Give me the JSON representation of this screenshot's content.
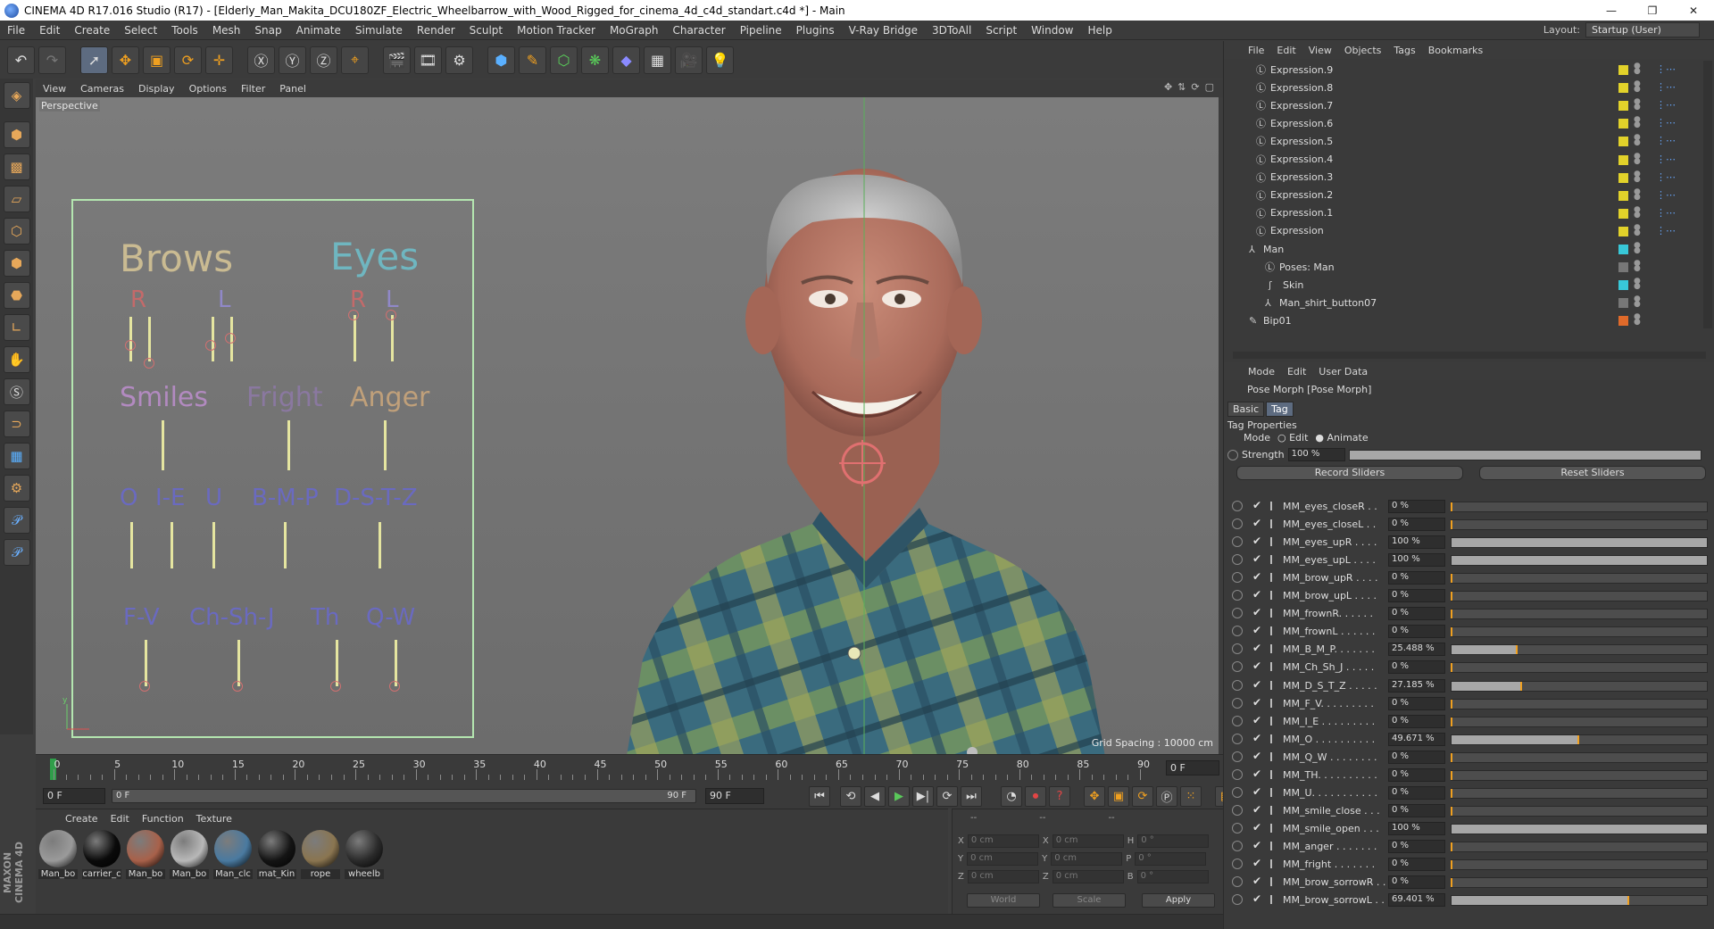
{
  "window": {
    "title": "CINEMA 4D R17.016 Studio (R17) - [Elderly_Man_Makita_DCU180ZF_Electric_Wheelbarrow_with_Wood_Rigged_for_cinema_4d_c4d_standart.c4d *] - Main",
    "controls": [
      "—",
      "❐",
      "✕"
    ]
  },
  "menubar": {
    "items": [
      "File",
      "Edit",
      "Create",
      "Select",
      "Tools",
      "Mesh",
      "Snap",
      "Animate",
      "Simulate",
      "Render",
      "Sculpt",
      "Motion Tracker",
      "MoGraph",
      "Character",
      "Pipeline",
      "Plugins",
      "V-Ray Bridge",
      "3DToAll",
      "Script",
      "Window",
      "Help"
    ],
    "layout_label": "Layout:",
    "layout_value": "Startup (User)"
  },
  "viewport": {
    "menu": [
      "View",
      "Cameras",
      "Display",
      "Options",
      "Filter",
      "Panel"
    ],
    "label": "Perspective",
    "grid_spacing": "Grid Spacing : 10000 cm",
    "face_panel": {
      "brows": "Brows",
      "eyes": "Eyes",
      "r1": "R",
      "l1": "L",
      "r2": "R",
      "l2": "L",
      "smiles": "Smiles",
      "fright": "Fright",
      "anger": "Anger",
      "o": "O",
      "ie": "I-E",
      "u": "U",
      "bmp": "B-M-P",
      "dstz": "D-S-T-Z",
      "fv": "F-V",
      "chshj": "Ch-Sh-J",
      "th": "Th",
      "qw": "Q-W"
    }
  },
  "timeline": {
    "ticks": [
      "0",
      "5",
      "10",
      "15",
      "20",
      "25",
      "30",
      "35",
      "40",
      "45",
      "50",
      "55",
      "60",
      "65",
      "70",
      "75",
      "80",
      "85",
      "90"
    ],
    "current_frame": "0 F",
    "start": "0 F",
    "range_left": "0 F",
    "range_right": "90 F",
    "end": "90 F"
  },
  "materials": {
    "menu": [
      "Create",
      "Edit",
      "Function",
      "Texture"
    ],
    "items": [
      {
        "name": "Man_bo",
        "color": "#9a9a9a"
      },
      {
        "name": "carrier_c",
        "color": "#0a0a0a"
      },
      {
        "name": "Man_bo",
        "color": "#a8614a"
      },
      {
        "name": "Man_bo",
        "color": "#b8b8b8"
      },
      {
        "name": "Man_clc",
        "color": "#4a7aa0"
      },
      {
        "name": "mat_Kin",
        "color": "#141414"
      },
      {
        "name": "rope",
        "color": "#8a7550"
      },
      {
        "name": "wheelb",
        "color": "#2a2a2a"
      }
    ]
  },
  "coords": {
    "col_headers": [
      "--",
      "--",
      "--"
    ],
    "x_label": "X",
    "y_label": "Y",
    "z_label": "Z",
    "h_label": "H",
    "p_label": "P",
    "b_label": "B",
    "pos": [
      "0 cm",
      "0 cm",
      "0 cm"
    ],
    "size": [
      "0 cm",
      "0 cm",
      "0 cm"
    ],
    "rot": [
      "0 °",
      "0 °",
      "0 °"
    ],
    "world": "World",
    "scale": "Scale",
    "apply": "Apply"
  },
  "objects": {
    "menu": [
      "File",
      "Edit",
      "View",
      "Objects",
      "Tags",
      "Bookmarks"
    ],
    "rows": [
      {
        "name": "Expression.9",
        "color": "#e2d22a"
      },
      {
        "name": "Expression.8",
        "color": "#e2d22a"
      },
      {
        "name": "Expression.7",
        "color": "#e2d22a"
      },
      {
        "name": "Expression.6",
        "color": "#e2d22a"
      },
      {
        "name": "Expression.5",
        "color": "#e2d22a"
      },
      {
        "name": "Expression.4",
        "color": "#e2d22a"
      },
      {
        "name": "Expression.3",
        "color": "#e2d22a"
      },
      {
        "name": "Expression.2",
        "color": "#e2d22a"
      },
      {
        "name": "Expression.1",
        "color": "#e2d22a"
      },
      {
        "name": "Expression",
        "color": "#e2d22a"
      },
      {
        "name": "Man",
        "color": "#38c8d8"
      },
      {
        "name": "Poses: Man",
        "color": "#777777"
      },
      {
        "name": "Skin",
        "color": "#38c8d8"
      },
      {
        "name": "Man_shirt_button07",
        "color": "#777777"
      },
      {
        "name": "Bip01",
        "color": "#e06a2a"
      }
    ]
  },
  "attributes": {
    "menu": [
      "Mode",
      "Edit",
      "User Data"
    ],
    "title": "Pose Morph [Pose Morph]",
    "tabs": [
      "Basic",
      "Tag"
    ],
    "section": "Tag Properties",
    "mode_label": "Mode",
    "mode_edit": "Edit",
    "mode_animate": "Animate",
    "strength_label": "Strength",
    "strength_value": "100 %",
    "record": "Record Sliders",
    "reset": "Reset Sliders",
    "sliders": [
      {
        "name": "MM_eyes_closeR . .",
        "value": "0 %",
        "fraction": 0
      },
      {
        "name": "MM_eyes_closeL . .",
        "value": "0 %",
        "fraction": 0
      },
      {
        "name": "MM_eyes_upR . . . .",
        "value": "100 %",
        "fraction": 1
      },
      {
        "name": "MM_eyes_upL . . . .",
        "value": "100 %",
        "fraction": 1
      },
      {
        "name": "MM_brow_upR . . . .",
        "value": "0 %",
        "fraction": 0
      },
      {
        "name": "MM_brow_upL . . . .",
        "value": "0 %",
        "fraction": 0
      },
      {
        "name": "MM_frownR. . . . . .",
        "value": "0 %",
        "fraction": 0
      },
      {
        "name": "MM_frownL . . . . . .",
        "value": "0 %",
        "fraction": 0
      },
      {
        "name": "MM_B_M_P. . . . . . .",
        "value": "25.488 %",
        "fraction": 0.25488
      },
      {
        "name": "MM_Ch_Sh_J . . . . .",
        "value": "0 %",
        "fraction": 0
      },
      {
        "name": "MM_D_S_T_Z . . . . .",
        "value": "27.185 %",
        "fraction": 0.27185
      },
      {
        "name": "MM_F_V. . . . . . . . .",
        "value": "0 %",
        "fraction": 0
      },
      {
        "name": "MM_I_E . . . . . . . . .",
        "value": "0 %",
        "fraction": 0
      },
      {
        "name": "MM_O . . . . . . . . . .",
        "value": "49.671 %",
        "fraction": 0.49671
      },
      {
        "name": "MM_Q_W . . . . . . . .",
        "value": "0 %",
        "fraction": 0
      },
      {
        "name": "MM_TH. . . . . . . . . .",
        "value": "0 %",
        "fraction": 0
      },
      {
        "name": "MM_U. . . . . . . . . . .",
        "value": "0 %",
        "fraction": 0
      },
      {
        "name": "MM_smile_close . . .",
        "value": "0 %",
        "fraction": 0
      },
      {
        "name": "MM_smile_open . . .",
        "value": "100 %",
        "fraction": 1
      },
      {
        "name": "MM_anger . . . . . . .",
        "value": "0 %",
        "fraction": 0
      },
      {
        "name": "MM_fright . . . . . . .",
        "value": "0 %",
        "fraction": 0
      },
      {
        "name": "MM_brow_sorrowR . .",
        "value": "0 %",
        "fraction": 0
      },
      {
        "name": "MM_brow_sorrowL . .",
        "value": "69.401 %",
        "fraction": 0.69401
      }
    ]
  }
}
